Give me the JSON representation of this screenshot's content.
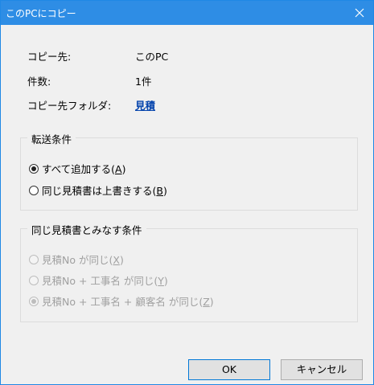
{
  "dialog": {
    "title": "このPCにコピー",
    "close_symbol": "✕"
  },
  "info": {
    "destination_label": "コピー先:",
    "destination_value": "このPC",
    "count_label": "件数:",
    "count_value": "1件",
    "folder_label": "コピー先フォルダ:",
    "folder_value": "見積"
  },
  "transfer": {
    "title": "転送条件",
    "options": [
      {
        "label": "すべて追加する(",
        "key": "A",
        "suffix": ")",
        "checked": true
      },
      {
        "label": "同じ見積書は上書きする(",
        "key": "B",
        "suffix": ")",
        "checked": false
      }
    ]
  },
  "same": {
    "title": "同じ見積書とみなす条件",
    "options": [
      {
        "label": "見積No が同じ(",
        "key": "X",
        "suffix": ")",
        "checked": false
      },
      {
        "label": "見積No + 工事名 が同じ(",
        "key": "Y",
        "suffix": ")",
        "checked": false
      },
      {
        "label": "見積No + 工事名 + 顧客名 が同じ(",
        "key": "Z",
        "suffix": ")",
        "checked": true
      }
    ]
  },
  "buttons": {
    "ok": "OK",
    "cancel": "キャンセル"
  },
  "colors": {
    "titlebar": "#2e8de5",
    "link": "#0645ad"
  }
}
